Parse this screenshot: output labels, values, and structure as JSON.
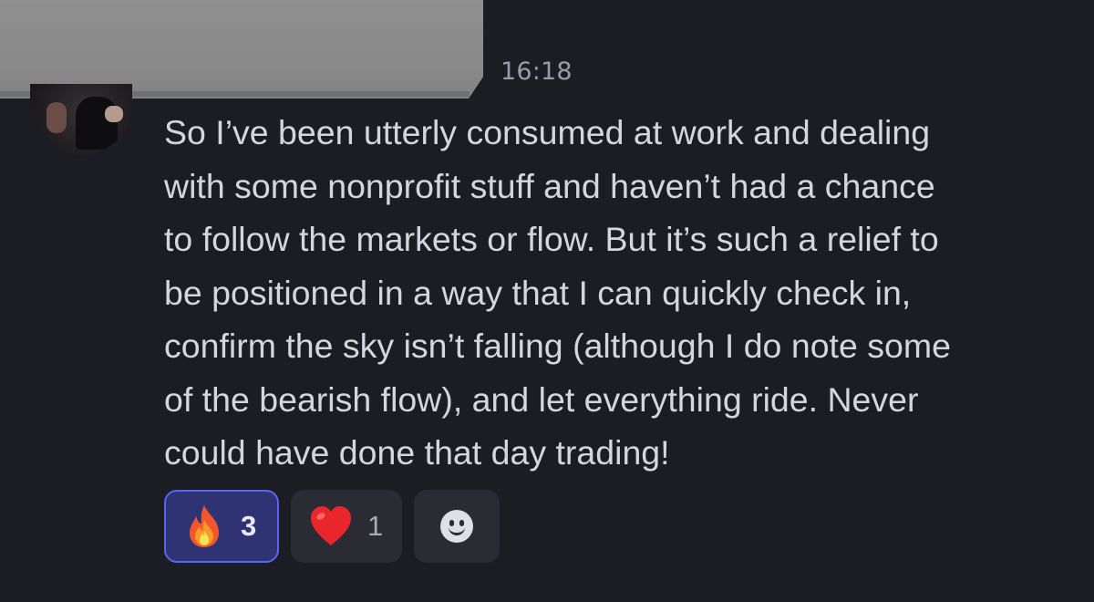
{
  "message": {
    "timestamp": "16:18",
    "text_lines": [
      "So I’ve been utterly consumed at work and dealing",
      "with some nonprofit stuff and haven’t had a chance",
      "to follow the markets or flow. But it’s such a relief to",
      "be positioned in a way that I can quickly check in,",
      "confirm the sky isn’t falling (although I do note some",
      "of the bearish flow), and let everything ride. Never",
      "could have done that day trading!"
    ]
  },
  "reactions": [
    {
      "emoji": "fire-emoji",
      "count": "3",
      "selected": true,
      "accent": "#5865f2"
    },
    {
      "emoji": "red-heart-emoji",
      "count": "1",
      "selected": false
    }
  ],
  "add_reaction": {
    "icon": "smiley-add-reaction-icon"
  },
  "colors": {
    "background": "#1c1d22",
    "text": "#d4d6dc",
    "timestamp": "#9b9ca5",
    "reaction_bg": "#2a2b33",
    "reaction_selected_bg": "#2f3373"
  }
}
